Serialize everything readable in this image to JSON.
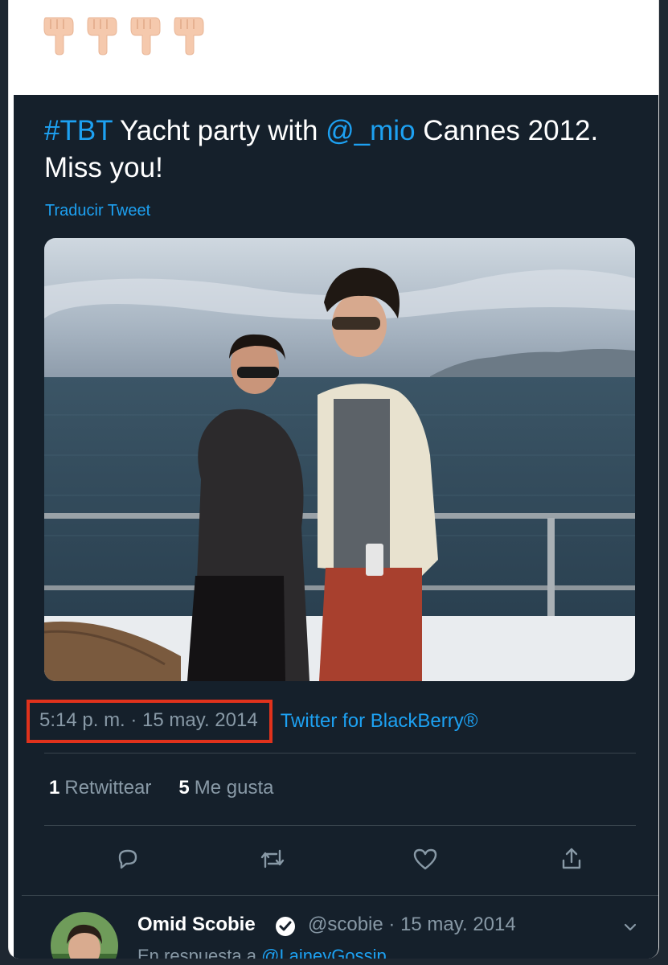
{
  "emoji_row": [
    "👇",
    "👇",
    "👇",
    "👇"
  ],
  "tweet": {
    "hashtag": "#TBT",
    "text_part1": " Yacht party with ",
    "mention": "@_mio",
    "text_part2": " Cannes 2012. Miss you!",
    "translate_label": "Traducir Tweet",
    "timestamp": "5:14 p. m. · 15 may. 2014",
    "source": "Twitter for BlackBerry®",
    "retweets_count": "1",
    "retweets_label": "Retwittear",
    "likes_count": "5",
    "likes_label": "Me gusta",
    "highlight_color": "#e0321c",
    "link_color": "#1da1f2",
    "background": "#15202b"
  },
  "actions": [
    "reply-icon",
    "retweet-icon",
    "like-icon",
    "share-icon"
  ],
  "reply": {
    "name": "Omid Scobie",
    "handle_date": "@scobie · 15 may. 2014",
    "subtext_prefix": "En respuesta a ",
    "subtext_mention": "@LaineyGossip"
  }
}
